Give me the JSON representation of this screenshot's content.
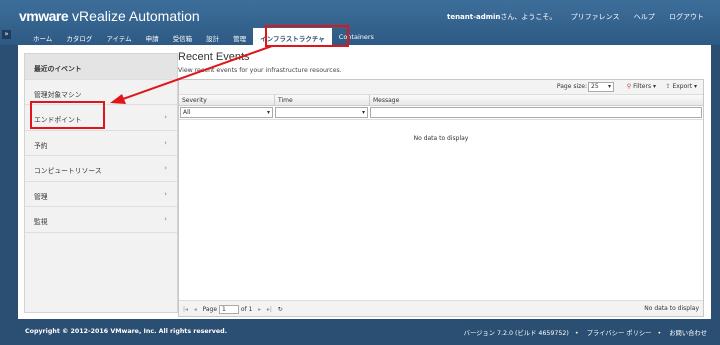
{
  "header": {
    "brand_bold": "vmware",
    "brand_product": "vRealize Automation",
    "user": "tenant-admin",
    "greeting": "さん、ようこそ。",
    "links": [
      "プリファレンス",
      "ヘルプ",
      "ログアウト"
    ],
    "collapse_icon": "expand-icon"
  },
  "nav": {
    "tabs": [
      "ホーム",
      "カタログ",
      "アイテム",
      "申請",
      "受信箱",
      "設計",
      "管理",
      "インフラストラクチャ",
      "Containers"
    ],
    "active": "インフラストラクチャ"
  },
  "sidebar": {
    "items": [
      {
        "label": "最近のイベント"
      },
      {
        "label": "管理対象マシン"
      },
      {
        "label": "エンドポイント",
        "arrow": "›"
      },
      {
        "label": "予約",
        "arrow": "›"
      },
      {
        "label": "コンピュートリソース",
        "arrow": "›"
      },
      {
        "label": "管理",
        "arrow": "›"
      },
      {
        "label": "監視",
        "arrow": "›"
      }
    ]
  },
  "main": {
    "title": "Recent Events",
    "subtitle": "View recent events for your infrastructure resources.",
    "page_size_label": "Page size:",
    "page_size": "25",
    "filters_label": "Filters",
    "export_label": "Export",
    "columns": [
      "Severity",
      "Time",
      "Message"
    ],
    "severity_filter": "All",
    "empty_text": "No data to display",
    "pager": {
      "page_label": "Page",
      "page_value": "1",
      "of_label": "of 1",
      "status": "No data to display"
    }
  },
  "footer": {
    "copyright": "Copyright © 2012-2016 VMware, Inc. All rights reserved.",
    "version": "バージョン 7.2.0 (ビルド 4659752)",
    "links": [
      "プライバシー ポリシー",
      "お問い合わせ"
    ]
  },
  "colors": {
    "header_blue": "#2d5a84",
    "annotation_red": "#e0151b"
  }
}
